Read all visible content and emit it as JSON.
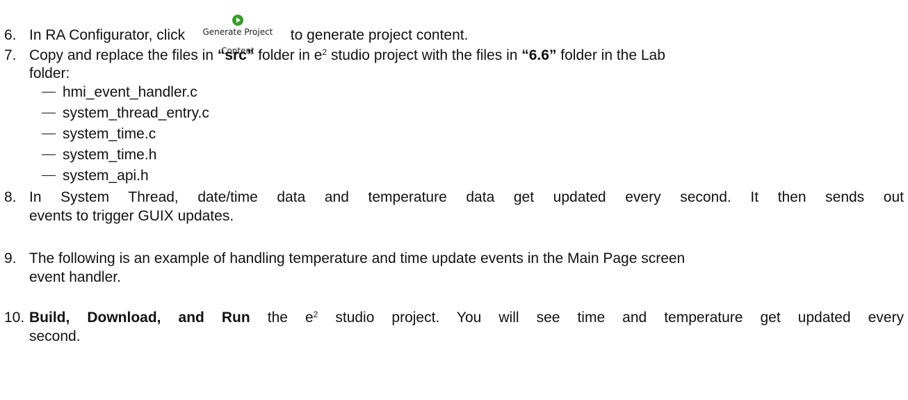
{
  "steps": [
    {
      "number": "6.",
      "before": "In RA Configurator, click ",
      "button_label": "Generate Project Content",
      "after": " to generate project content."
    },
    {
      "number": "7.",
      "t1": "Copy and replace the files in ",
      "b1": "“src”",
      "t2": " folder in e",
      "sup": "2",
      "t3": " studio project with the files in ",
      "b2": "“6.6”",
      "t4": " folder in the Lab",
      "line2": "folder:",
      "files": [
        "hmi_event_handler.c",
        "system_thread_entry.c",
        "system_time.c",
        "system_time.h",
        "system_api.h"
      ]
    },
    {
      "number": "8.",
      "line1": "In System Thread, date/time data and temperature data get updated every second. It then sends out",
      "line2": "events to trigger GUIX updates."
    },
    {
      "number": "9.",
      "line1": "The following is an example of handling temperature and time update events in the Main Page screen",
      "line2": "event handler."
    },
    {
      "number": "10.",
      "bold": "Build, Download, and Run",
      "t1": " the e",
      "sup": "2",
      "t2": " studio project. You will see time and temperature get updated every",
      "line2": "second."
    }
  ]
}
